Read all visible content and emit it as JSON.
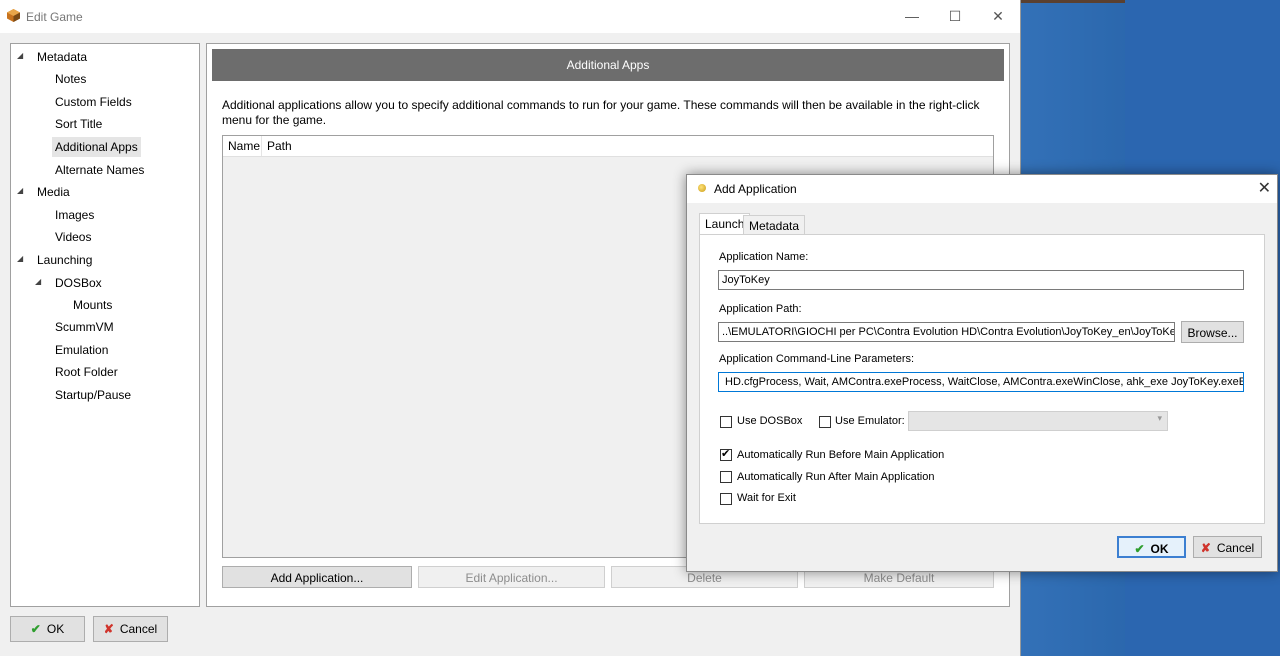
{
  "window": {
    "title": "Edit Game",
    "minimize_icon": "—",
    "maximize_icon": "☐",
    "close_icon": "✕"
  },
  "tree": {
    "metadata": "Metadata",
    "notes": "Notes",
    "custom_fields": "Custom Fields",
    "sort_title": "Sort Title",
    "additional_apps": "Additional Apps",
    "alternate_names": "Alternate Names",
    "media": "Media",
    "images": "Images",
    "videos": "Videos",
    "launching": "Launching",
    "dosbox": "DOSBox",
    "mounts": "Mounts",
    "scummvm": "ScummVM",
    "emulation": "Emulation",
    "root_folder": "Root Folder",
    "startup_pause": "Startup/Pause"
  },
  "content": {
    "header": "Additional Apps",
    "description": "Additional applications allow you to specify additional commands to run for your game.  These commands will then be available in the right-click menu for the game.",
    "columns": [
      "Name",
      "Path"
    ],
    "buttons": {
      "add": "Add Application...",
      "edit": "Edit Application...",
      "delete": "Delete",
      "make_default": "Make Default"
    }
  },
  "footer": {
    "ok": "OK",
    "cancel": "Cancel",
    "ok_icon": "✔",
    "cancel_icon": "✘"
  },
  "dialog": {
    "title": "Add Application",
    "close_icon": "✕",
    "tabs": [
      "Launch",
      "Metadata"
    ],
    "app_name_label": "Application Name:",
    "app_name_value": "JoyToKey",
    "app_path_label": "Application Path:",
    "app_path_value": "..\\EMULATORI\\GIOCHI per PC\\Contra Evolution HD\\Contra Evolution\\JoyToKey_en\\JoyToKey.exe",
    "browse": "Browse...",
    "cmdline_label": "Application Command-Line Parameters:",
    "cmdline_value": "HD.cfgProcess, Wait, AMContra.exeProcess, WaitClose, AMContra.exeWinClose, ahk_exe JoyToKey.exeExitApp",
    "use_dosbox": "Use DOSBox",
    "use_emulator": "Use Emulator:",
    "auto_run_before": "Automatically Run Before Main Application",
    "auto_run_after": "Automatically Run After Main Application",
    "wait_for_exit": "Wait for Exit",
    "checks": {
      "use_dosbox": false,
      "use_emulator": false,
      "auto_run_before": true,
      "auto_run_after": false,
      "wait_for_exit": false
    },
    "check_mark": "✔",
    "ok": "OK",
    "cancel": "Cancel"
  }
}
